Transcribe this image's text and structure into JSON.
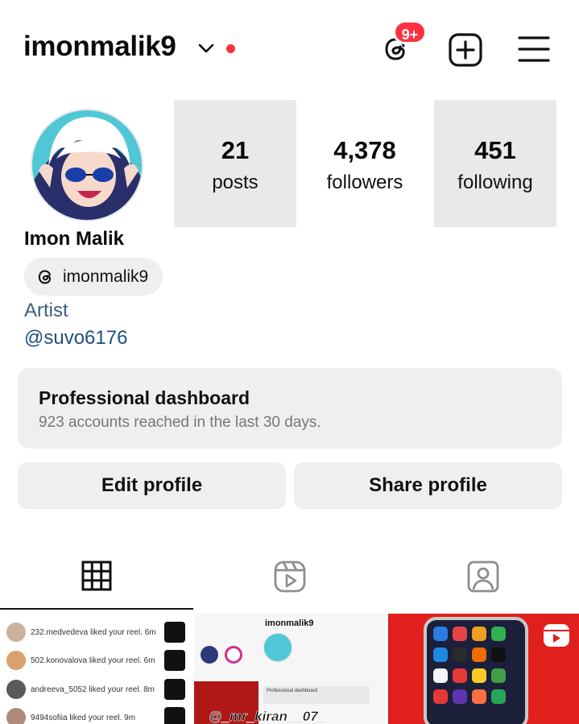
{
  "header": {
    "username": "imonmalik9",
    "notification_badge": "9+",
    "accent_red": "#ff3040"
  },
  "profile": {
    "full_name": "Imon Malik",
    "threads_handle": "imonmalik9",
    "category": "Artist",
    "handle_link": "@suvo6176"
  },
  "stats": [
    {
      "value": "21",
      "label": "posts"
    },
    {
      "value": "4,378",
      "label": "followers"
    },
    {
      "value": "451",
      "label": "following"
    }
  ],
  "dashboard": {
    "title": "Professional dashboard",
    "subtitle": "923 accounts reached in the last 30 days."
  },
  "actions": {
    "edit_label": "Edit profile",
    "share_label": "Share profile"
  },
  "tabs": [
    {
      "icon": "grid-icon",
      "active": true
    },
    {
      "icon": "reels-icon",
      "active": false
    },
    {
      "icon": "tagged-icon",
      "active": false
    }
  ],
  "posts": {
    "tile1_notifications": [
      "232.medvedeva liked your reel. 6m",
      "502.konovalova liked your reel. 6m",
      "andreeva_5052 liked your reel. 8m",
      "9494sofiia liked your reel. 9m"
    ],
    "tile2_username": "imonmalik9",
    "tile2_dashboard": "Professional dashboard",
    "tile2_overlay": "@_mr_kiran__07_"
  }
}
